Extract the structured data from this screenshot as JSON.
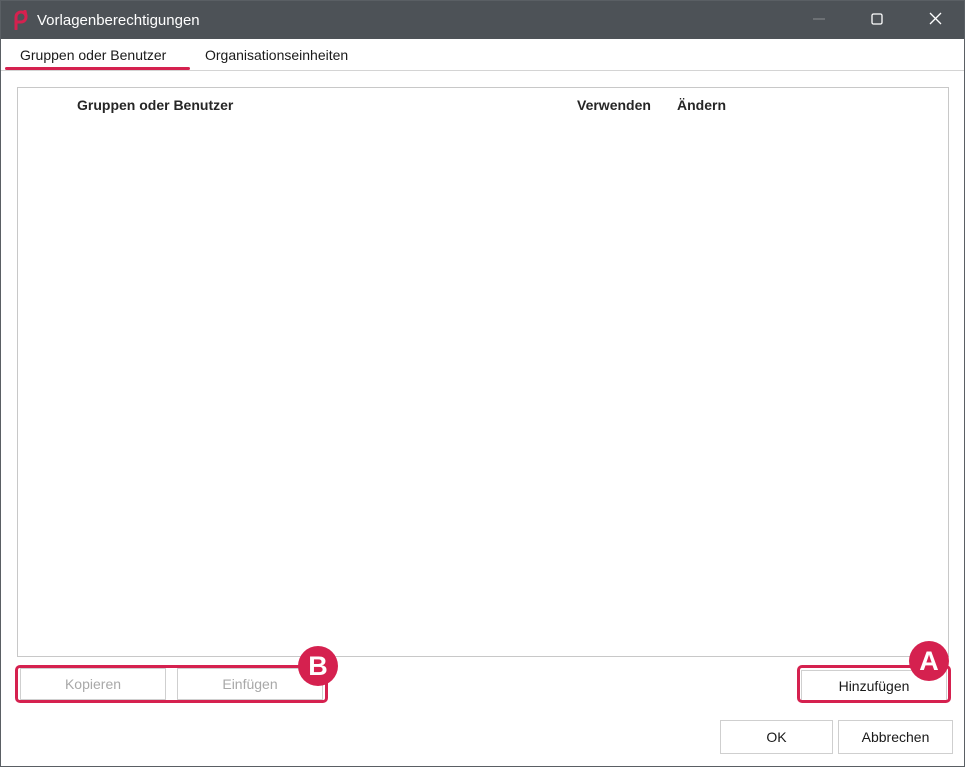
{
  "window": {
    "title": "Vorlagenberechtigungen",
    "icon": "app-logo-icon",
    "controls": [
      "minimize-icon",
      "maximize-icon",
      "close-icon"
    ]
  },
  "tabs": [
    {
      "label": "Gruppen oder Benutzer",
      "active": true
    },
    {
      "label": "Organisationseinheiten",
      "active": false
    }
  ],
  "table": {
    "columns": [
      "Gruppen oder Benutzer",
      "Verwenden",
      "Ändern"
    ],
    "rows": []
  },
  "buttons": {
    "copy": "Kopieren",
    "paste": "Einfügen",
    "add": "Hinzufügen",
    "ok": "OK",
    "cancel": "Abbrechen"
  },
  "annotations": {
    "a": "A",
    "b": "B"
  },
  "colors": {
    "accent": "#d5214f",
    "titlebar": "#4d5257"
  }
}
